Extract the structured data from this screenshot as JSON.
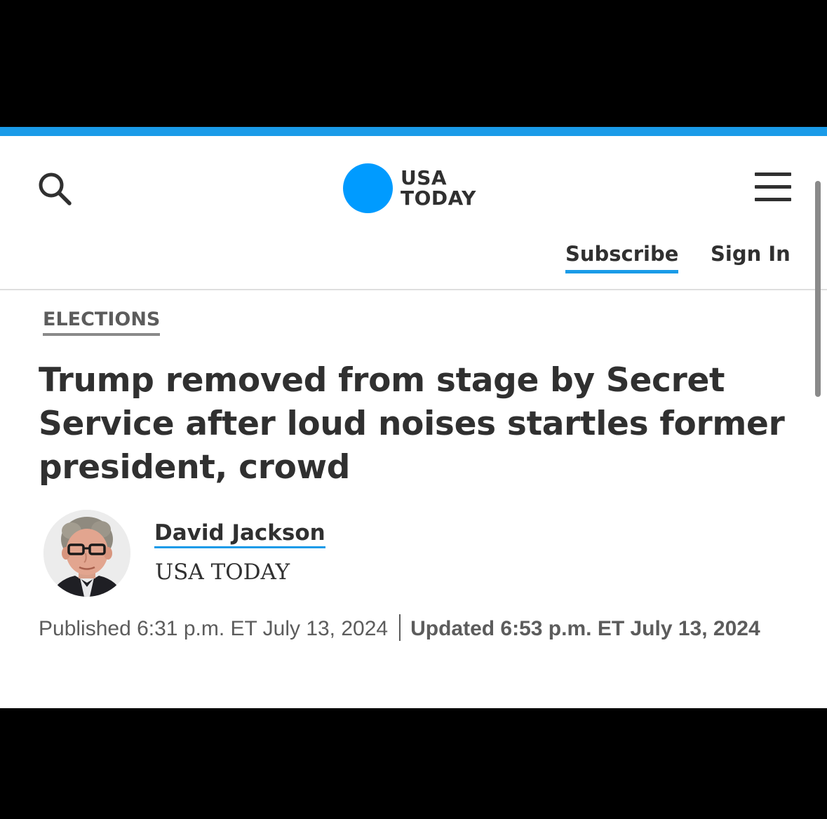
{
  "header": {
    "logo_line1": "USA",
    "logo_line2": "TODAY",
    "subscribe_label": "Subscribe",
    "signin_label": "Sign In",
    "search_icon": "search-icon",
    "menu_icon": "hamburger-menu-icon"
  },
  "article": {
    "section": "ELECTIONS",
    "headline": "Trump removed from stage by Secret Service after loud noises startles former president, crowd",
    "author_name": "David Jackson",
    "author_outlet": "USA TODAY",
    "published": "Published 6:31 p.m. ET July 13, 2024",
    "updated": "Updated 6:53 p.m. ET July 13, 2024"
  },
  "colors": {
    "accent": "#1a9be8",
    "logo": "#009bff",
    "text": "#303030",
    "muted": "#5c5c5c"
  }
}
